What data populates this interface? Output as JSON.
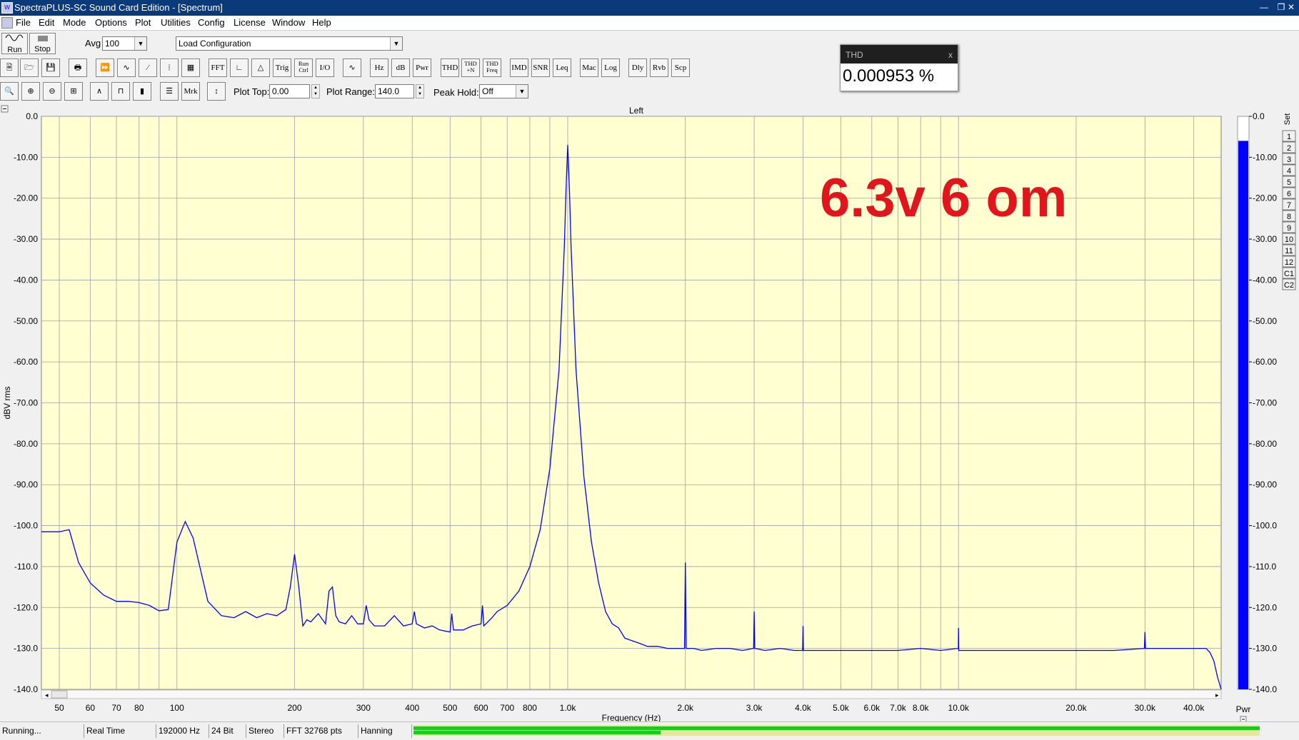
{
  "window": {
    "title": "SpectraPLUS-SC Sound Card Edition - [Spectrum]"
  },
  "menu": [
    "File",
    "Edit",
    "Mode",
    "Options",
    "Plot",
    "Utilities",
    "Config",
    "License",
    "Window",
    "Help"
  ],
  "toolbar1": {
    "run_label": "Run",
    "stop_label": "Stop",
    "avg_label": "Avg",
    "avg_value": "100",
    "config_value": "Load Configuration"
  },
  "toolbar2": [
    "FFT",
    "Trig",
    "Run Ctrl",
    "I/O",
    "Hz",
    "dB",
    "Pwr",
    "THD",
    "THD +N",
    "THD Freq",
    "IMD",
    "SNR",
    "Leq",
    "Mac",
    "Log",
    "Dly",
    "Rvb",
    "Scp"
  ],
  "toolbar3": {
    "mrk_label": "Mrk",
    "plot_top_label": "Plot Top:",
    "plot_top_value": "0.00",
    "plot_range_label": "Plot Range:",
    "plot_range_value": "140.0",
    "peak_hold_label": "Peak Hold:",
    "peak_hold_value": "Off"
  },
  "thd_window": {
    "title": "THD",
    "value": "0.000953 %"
  },
  "plot": {
    "channel": "Left",
    "annotation": "6.3v 6 om",
    "annotation_color": "#e0161c",
    "background": "#ffffd2",
    "trace_color": "#0000ff"
  },
  "set_panel": {
    "title": "Set",
    "items": [
      "1",
      "2",
      "3",
      "4",
      "5",
      "6",
      "7",
      "8",
      "9",
      "10",
      "11",
      "12",
      "C1",
      "C2"
    ]
  },
  "pwr_bar": {
    "label": "Pwr",
    "level_db": -6.0,
    "color": "#0000ff"
  },
  "status": {
    "state": "Running...",
    "mode": "Real Time",
    "rate": "192000 Hz",
    "bits": "24 Bit",
    "channels": "Stereo",
    "fft": "FFT 32768 pts",
    "window": "Hanning"
  },
  "chart_data": {
    "type": "line",
    "title": "Left",
    "xlabel": "Frequency (Hz)",
    "ylabel": "dBV rms",
    "xscale": "log",
    "xlim": [
      45,
      47000
    ],
    "ylim": [
      -140,
      0
    ],
    "yticks": [
      0,
      -10,
      -20,
      -30,
      -40,
      -50,
      -60,
      -70,
      -80,
      -90,
      -100,
      -110,
      -120,
      -130,
      -140
    ],
    "ytick_labels": [
      "0.0",
      "-10.00",
      "-20.00",
      "-30.00",
      "-40.00",
      "-50.00",
      "-60.00",
      "-70.00",
      "-80.00",
      "-90.00",
      "-100.0",
      "-110.0",
      "-120.0",
      "-130.0",
      "-140.0"
    ],
    "xticks": [
      50,
      60,
      70,
      80,
      100,
      200,
      300,
      400,
      500,
      600,
      700,
      800,
      1000,
      2000,
      3000,
      4000,
      5000,
      6000,
      7000,
      8000,
      10000,
      20000,
      30000,
      40000
    ],
    "xtick_labels": [
      "50",
      "60",
      "70",
      "80",
      "100",
      "200",
      "300",
      "400",
      "500",
      "600",
      "700",
      "800",
      "1.0k",
      "2.0k",
      "3.0k",
      "4.0k",
      "5.0k",
      "6.0k",
      "7.0k",
      "8.0k",
      "10.0k",
      "20.0k",
      "30.0k",
      "40.0k"
    ],
    "grid": true,
    "series": [
      {
        "x": [
          45,
          50,
          53,
          56,
          60,
          65,
          70,
          75,
          80,
          85,
          90,
          95,
          100,
          105,
          110,
          120,
          130,
          140,
          150,
          160,
          170,
          180,
          190,
          195,
          200,
          205,
          210,
          215,
          220,
          230,
          240,
          245,
          250,
          255,
          260,
          270,
          280,
          290,
          300,
          305,
          310,
          320,
          340,
          360,
          380,
          400,
          405,
          410,
          430,
          450,
          470,
          500,
          505,
          510,
          540,
          570,
          600,
          605,
          610,
          640,
          660,
          700,
          750,
          800,
          850,
          900,
          950,
          980,
          990,
          1000,
          1010,
          1020,
          1050,
          1100,
          1150,
          1200,
          1250,
          1300,
          1350,
          1400,
          1450,
          1500,
          1550,
          1600,
          1700,
          1800,
          1900,
          1990,
          2000,
          2010,
          2100,
          2200,
          2400,
          2600,
          2800,
          2990,
          3000,
          3010,
          3200,
          3500,
          3800,
          3990,
          4000,
          4010,
          4500,
          5000,
          5500,
          6000,
          7000,
          8000,
          9000,
          9990,
          10000,
          10010,
          12000,
          15000,
          18000,
          20000,
          25000,
          29900,
          30000,
          30100,
          35000,
          40000,
          42000,
          43000,
          44000,
          45000,
          46000,
          47000
        ],
        "y": [
          -101.5,
          -101.5,
          -101,
          -109,
          -114,
          -117,
          -118.5,
          -118.5,
          -118.8,
          -119.5,
          -120.8,
          -120.5,
          -104,
          -99,
          -103,
          -118.5,
          -122,
          -122.5,
          -121,
          -122.5,
          -121.5,
          -122,
          -120.5,
          -115,
          -107,
          -115,
          -124.5,
          -123,
          -123.5,
          -121.5,
          -124,
          -116,
          -115,
          -122,
          -123.5,
          -124,
          -122,
          -124,
          -124,
          -119.5,
          -123,
          -124.5,
          -124.5,
          -122,
          -124.5,
          -124,
          -121,
          -124,
          -125,
          -124.5,
          -125.5,
          -126,
          -121.5,
          -125.5,
          -125.5,
          -124.5,
          -124,
          -119.5,
          -124.5,
          -122.5,
          -121,
          -119.5,
          -116,
          -110,
          -101,
          -86,
          -62,
          -32,
          -18,
          -7,
          -18,
          -32,
          -62,
          -88,
          -104,
          -114,
          -121,
          -124,
          -125,
          -127.5,
          -128,
          -128.5,
          -129,
          -129.5,
          -129.5,
          -130,
          -130,
          -130,
          -109,
          -130,
          -130,
          -130.5,
          -130,
          -130,
          -130.5,
          -130,
          -121,
          -130,
          -130.5,
          -130,
          -130.5,
          -130.5,
          -124.5,
          -130.5,
          -130.5,
          -130.5,
          -130.5,
          -130.5,
          -130.5,
          -130,
          -130.5,
          -130,
          -125,
          -130.5,
          -130.5,
          -130.5,
          -130.5,
          -130.5,
          -130.5,
          -130,
          -126,
          -130,
          -130,
          -130,
          -130,
          -130,
          -131,
          -133,
          -137,
          -140
        ]
      }
    ]
  }
}
